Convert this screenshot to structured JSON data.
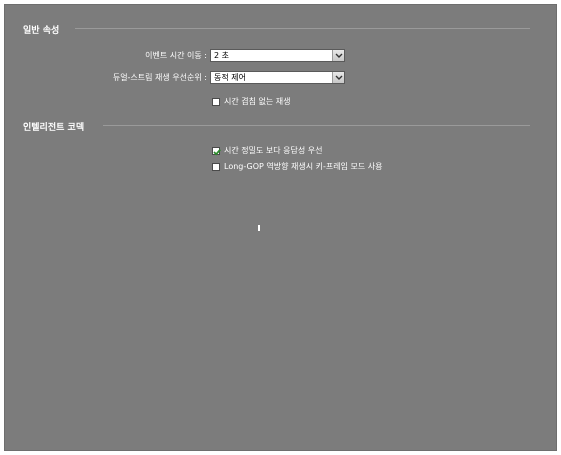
{
  "general": {
    "title": "일반 속성",
    "event_time_move": {
      "label": "이벤트 시간 이동 :",
      "value": "2 초"
    },
    "dual_stream_priority": {
      "label": "듀얼-스트림 재생 우선순위 :",
      "value": "동적 제어"
    },
    "no_overlap_playback": {
      "label": "시간 겹침 없는 재생",
      "checked": false
    }
  },
  "intelligent_codec": {
    "title": "인텔리전트 코덱",
    "responsiveness_over_accuracy": {
      "label": "시간 정밀도 보다 응답성 우선",
      "checked": true
    },
    "long_gop_keyframe_mode": {
      "label": "Long-GOP 역방향 재생시 키-프레임 모드 사용",
      "checked": false
    }
  },
  "colors": {
    "panel_background": "#7c7c7c",
    "text": "#ffffff",
    "check_mark": "#2a8a2a"
  }
}
